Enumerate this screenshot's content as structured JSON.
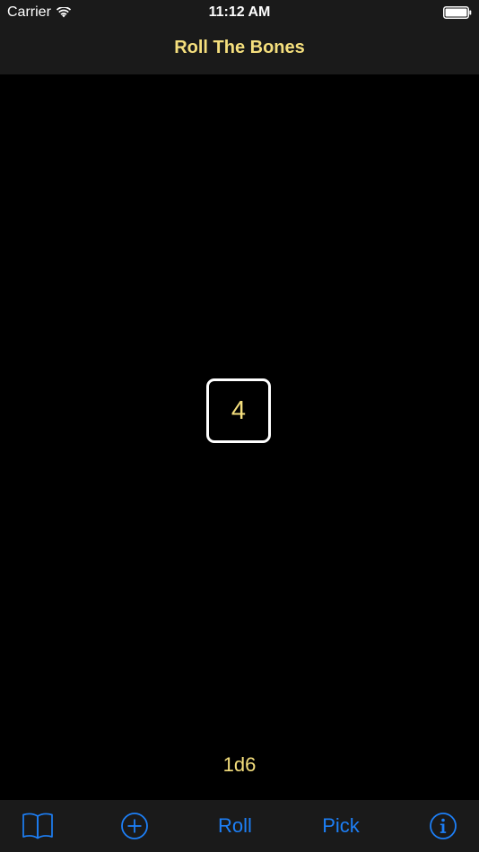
{
  "status_bar": {
    "carrier": "Carrier",
    "time": "11:12 AM"
  },
  "nav": {
    "title": "Roll The Bones"
  },
  "dice": [
    {
      "value": "4"
    }
  ],
  "dice_spec": "1d6",
  "toolbar": {
    "library_icon": "book-icon",
    "add_icon": "plus-circle-icon",
    "roll_label": "Roll",
    "pick_label": "Pick",
    "info_icon": "info-circle-icon"
  },
  "colors": {
    "accent": "#1d7ff6",
    "title": "#f5df7d",
    "bar_bg": "#1a1a1a",
    "background": "#000000"
  }
}
